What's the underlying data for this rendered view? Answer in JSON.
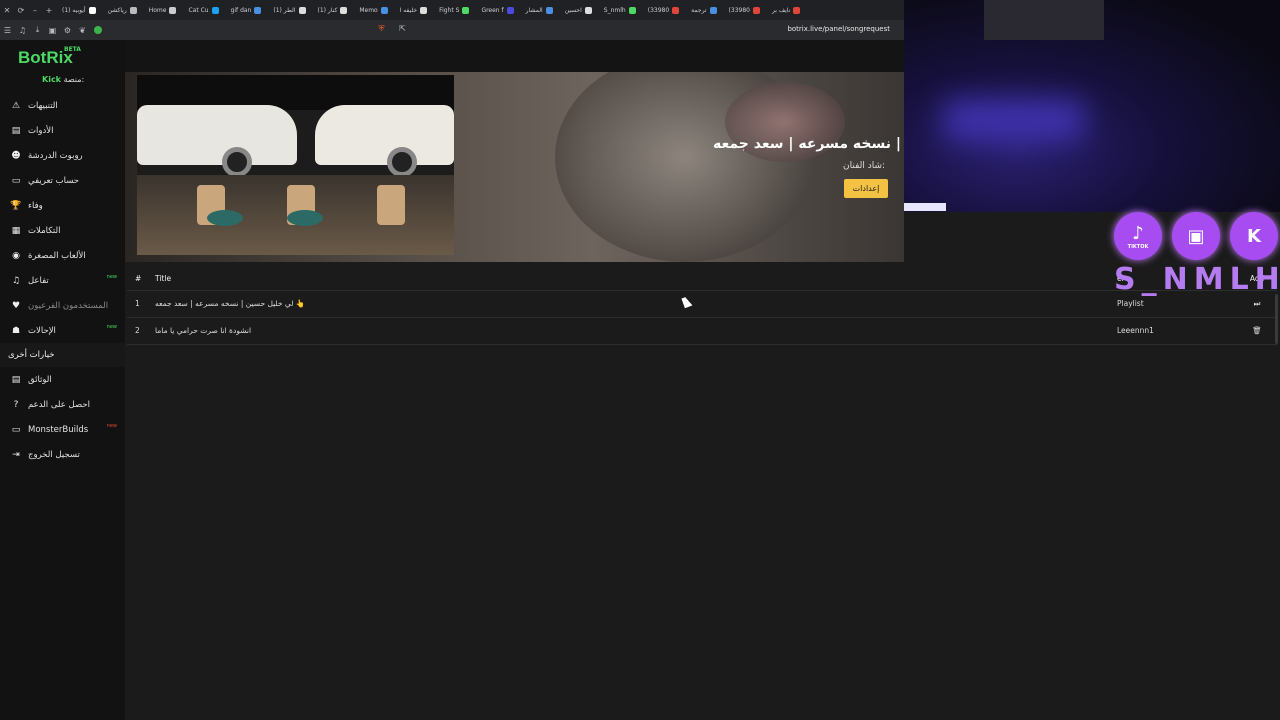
{
  "browser": {
    "tabs": [
      {
        "label": "أيوبيه (1)",
        "color": "#ffffff"
      },
      {
        "label": "رياكشن",
        "color": "#bbbbbb"
      },
      {
        "label": "Home",
        "color": "#cccccc"
      },
      {
        "label": "Cat Cu",
        "color": "#1da1f2"
      },
      {
        "label": "gif dan",
        "color": "#4a90e2"
      },
      {
        "label": "(1) الطر",
        "color": "#dddddd"
      },
      {
        "label": "(1) كنار",
        "color": "#dddddd"
      },
      {
        "label": "Memo",
        "color": "#4a90e2"
      },
      {
        "label": "خليفه ا",
        "color": "#dddddd"
      },
      {
        "label": "Fight S",
        "color": "#4cd964"
      },
      {
        "label": "Green f",
        "color": "#4a4ae0"
      },
      {
        "label": "المشار",
        "color": "#4a90e2"
      },
      {
        "label": "احسين",
        "color": "#dddddd"
      },
      {
        "label": "S_nmlh",
        "color": "#4cd964"
      },
      {
        "label": "(33980",
        "color": "#e0453a"
      },
      {
        "label": "ترجمة",
        "color": "#4a90e2"
      },
      {
        "label": "(33980",
        "color": "#e0453a"
      },
      {
        "label": "نايف بر",
        "color": "#e0453a"
      }
    ],
    "url": "botrix.live/panel/songrequest"
  },
  "sidebar": {
    "logo": "BotRix",
    "beta": "BETA",
    "platform_label": "منصة:",
    "platform_value": "Kick",
    "items": [
      {
        "label": "التنبيهات",
        "icon": "warning-icon",
        "glyph": "⚠"
      },
      {
        "label": "الأدوات",
        "icon": "tools-icon",
        "glyph": "▤"
      },
      {
        "label": "روبوت الدردشة",
        "icon": "robot-icon",
        "glyph": "☻"
      },
      {
        "label": "حساب تعريفي",
        "icon": "id-card-icon",
        "glyph": "▭"
      },
      {
        "label": "وفاء",
        "icon": "trophy-icon",
        "glyph": "🏆"
      },
      {
        "label": "التكاملات",
        "icon": "integrations-icon",
        "glyph": "▦"
      },
      {
        "label": "الألعاب المصغرة",
        "icon": "gamepad-icon",
        "glyph": "◉"
      },
      {
        "label": "تفاعل",
        "icon": "music-icon",
        "glyph": "♫",
        "badge": "new"
      },
      {
        "label": "المستخدمون الفرعيون",
        "icon": "sub-users-icon",
        "glyph": "♥",
        "dim": true
      },
      {
        "label": "الإحالات",
        "icon": "users-icon",
        "glyph": "☗",
        "badge": "new"
      }
    ],
    "section_title": "خيارات أخرى",
    "other_items": [
      {
        "label": "الوثائق",
        "icon": "docs-icon",
        "glyph": "▤"
      },
      {
        "label": "احصل على الدعم",
        "icon": "help-icon",
        "glyph": "?"
      },
      {
        "label": "MonsterBuilds",
        "icon": "laptop-icon",
        "glyph": "▭",
        "badge": "new"
      },
      {
        "label": "تسجيل الخروج",
        "icon": "logout-icon",
        "glyph": "⇥"
      }
    ]
  },
  "player": {
    "title": "ن | نسخه مسرعه | سعد جمعه",
    "artist_label": "شاد الفنان:",
    "settings_button": "إعدادات"
  },
  "queue": {
    "columns": [
      "#",
      "Title",
      "er",
      "Acti"
    ],
    "rows": [
      {
        "num": "1",
        "title": "لي خليل حسين | نسخه مسرعه | سعد جمعه 👆",
        "requester": "Playlist",
        "action": "skip-icon",
        "glyph": "⏭"
      },
      {
        "num": "2",
        "title": "انشودة انا صرت حرامي يا ماما",
        "requester": "Leeennn1",
        "action": "delete-icon",
        "glyph": "🗑"
      }
    ]
  },
  "overlay": {
    "socials": [
      {
        "name": "tiktok-icon",
        "glyph": "♪",
        "label": "TIKTOK"
      },
      {
        "name": "twitch-icon",
        "glyph": "▣",
        "label": ""
      },
      {
        "name": "kick-icon",
        "glyph": "K",
        "label": ""
      }
    ],
    "handle": "S_NMLH"
  }
}
